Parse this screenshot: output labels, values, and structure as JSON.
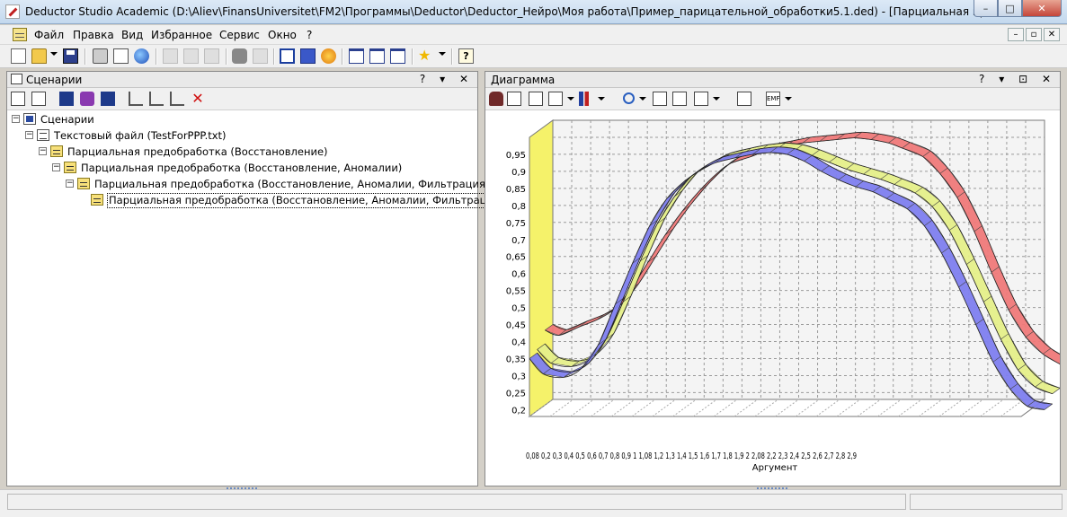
{
  "window": {
    "title": "Deductor Studio Academic (D:\\Aliev\\FinansUniversitet\\FM2\\Программы\\Deductor\\Deductor_Нейро\\Моя работа\\Пример_парицательной_обработки5.1.ded) - [Парциальная пр]",
    "minimize": "–",
    "maximize": "□",
    "close": "✕"
  },
  "menu": {
    "items": [
      "Файл",
      "Правка",
      "Вид",
      "Избранное",
      "Сервис",
      "Окно",
      "?"
    ],
    "mdi": [
      "–",
      "▫",
      "✕"
    ]
  },
  "left_panel": {
    "title": "Сценарии",
    "head_buttons": "? ▾ ✕",
    "tree": [
      {
        "label": "Сценарии",
        "expander": "−",
        "icon": "scenario-icon"
      },
      {
        "label": "Текстовый файл (TestForPPP.txt)",
        "expander": "−",
        "icon": "text-file-icon"
      },
      {
        "label": "Парциальная предобработка (Восстановление)",
        "expander": "−",
        "icon": "processing-icon"
      },
      {
        "label": "Парциальная предобработка (Восстановление, Аномалии)",
        "expander": "−",
        "icon": "processing-icon"
      },
      {
        "label": "Парциальная предобработка (Восстановление, Аномалии, Фильтрация (Вейвлет))",
        "expander": "−",
        "icon": "processing-icon"
      },
      {
        "label": "Парциальная предобработка (Восстановление, Аномалии, Фильтрация(Шумы))",
        "expander": "",
        "icon": "processing-icon",
        "selected": true
      }
    ]
  },
  "right_panel": {
    "title": "Диаграмма",
    "head_buttons": "? ▾ ⊡ ✕"
  },
  "chart_data": {
    "type": "line",
    "title": "",
    "xlabel": "Аргумент",
    "ylabel": "",
    "ylim": [
      0.18,
      1.0
    ],
    "x_tick_labels": [
      "0,08",
      "0,2",
      "0,3",
      "0,4",
      "0,5",
      "0,6",
      "0,7",
      "0,8",
      "0,9",
      "1",
      "1,08",
      "1,2",
      "1,3",
      "1,4",
      "1,5",
      "1,6",
      "1,7",
      "1,8",
      "1,9",
      "2",
      "2,08",
      "2,2",
      "2,3",
      "2,4",
      "2,5",
      "2,6",
      "2,7",
      "2,8",
      "2,9"
    ],
    "x_tick_text": "0,08 0,2 0,3 0,4 0,5 0,6 0,7 0,8 0,9 1 1,08 1,2 1,3 1,4 1,5 1,6 1,7 1,8 1,9 2 2,08 2,2 2,3 2,4 2,5 2,6 2,7 2,8 2,9",
    "y_tick_labels": [
      "0,95",
      "0,9",
      "0,85",
      "0,8",
      "0,75",
      "0,7",
      "0,65",
      "0,6",
      "0,55",
      "0,5",
      "0,45",
      "0,4",
      "0,35",
      "0,3",
      "0,25",
      "0,2"
    ],
    "grid": true,
    "style": "3d-ribbon",
    "x": [
      0,
      0.08,
      0.2,
      0.3,
      0.4,
      0.5,
      0.6,
      0.7,
      0.8,
      0.9,
      1.0,
      1.08,
      1.2,
      1.3,
      1.4,
      1.5,
      1.6,
      1.7,
      1.8,
      1.9,
      2.0,
      2.08,
      2.2,
      2.3,
      2.4,
      2.5,
      2.6,
      2.7,
      2.8,
      2.9,
      3.0
    ],
    "series": [
      {
        "color": "#f07a7a",
        "values": [
          0.4,
          0.385,
          0.41,
          0.43,
          0.46,
          0.52,
          0.6,
          0.68,
          0.75,
          0.81,
          0.86,
          0.89,
          0.91,
          0.93,
          0.94,
          0.95,
          0.955,
          0.96,
          0.965,
          0.96,
          0.95,
          0.935,
          0.91,
          0.86,
          0.79,
          0.69,
          0.57,
          0.46,
          0.38,
          0.33,
          0.3
        ]
      },
      {
        "color": "#e6f08a",
        "values": [
          0.36,
          0.32,
          0.31,
          0.33,
          0.39,
          0.5,
          0.62,
          0.73,
          0.81,
          0.87,
          0.9,
          0.92,
          0.935,
          0.945,
          0.95,
          0.945,
          0.93,
          0.91,
          0.89,
          0.875,
          0.86,
          0.845,
          0.82,
          0.78,
          0.71,
          0.61,
          0.5,
          0.39,
          0.3,
          0.25,
          0.23
        ]
      },
      {
        "color": "#8080f0",
        "values": [
          0.35,
          0.305,
          0.295,
          0.32,
          0.39,
          0.51,
          0.63,
          0.74,
          0.82,
          0.87,
          0.905,
          0.925,
          0.94,
          0.95,
          0.955,
          0.95,
          0.93,
          0.9,
          0.875,
          0.855,
          0.84,
          0.82,
          0.79,
          0.74,
          0.66,
          0.56,
          0.45,
          0.34,
          0.26,
          0.21,
          0.2
        ]
      }
    ]
  }
}
